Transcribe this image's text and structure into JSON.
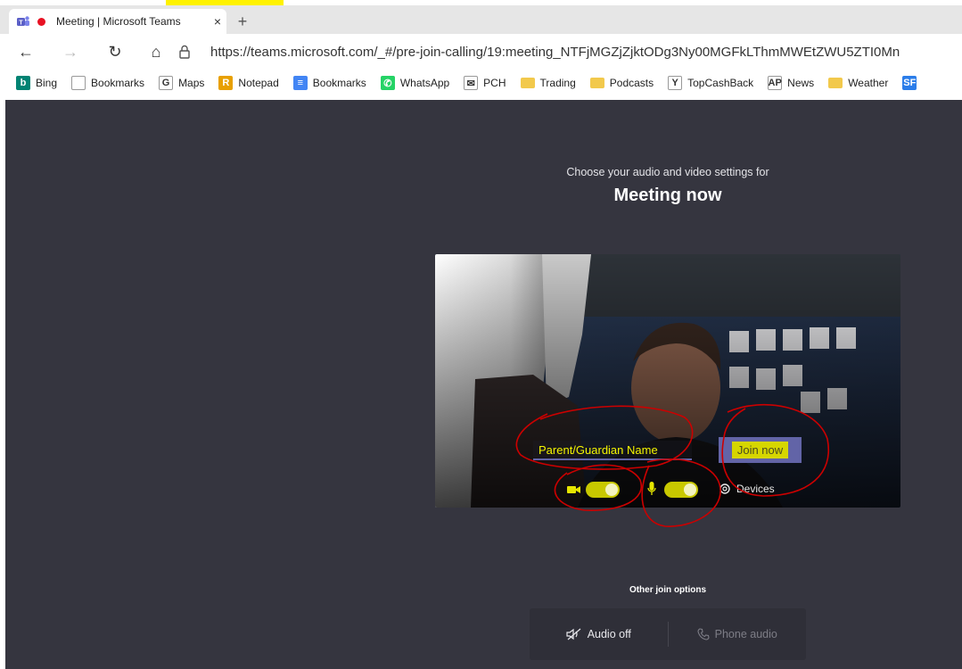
{
  "browser": {
    "tab_title": "Meeting | Microsoft Teams",
    "tab_close": "×",
    "new_tab": "+",
    "url": "https://teams.microsoft.com/_#/pre-join-calling/19:meeting_NTFjMGZjZjktODg3Ny00MGFkLThmMWEtZWU5ZTI0Mn",
    "back": "←",
    "forward": "→",
    "reload": "↻",
    "home": "⌂"
  },
  "bookmarks": [
    {
      "label": "Bing",
      "icon": "bing-icon",
      "color": "#008373",
      "glyph": "b"
    },
    {
      "label": "Bookmarks",
      "icon": "page-icon",
      "color": "#ffffff",
      "glyph": ""
    },
    {
      "label": "Maps",
      "icon": "google-icon",
      "color": "#ffffff",
      "glyph": "G"
    },
    {
      "label": "Notepad",
      "icon": "notepad-icon",
      "color": "#e8a000",
      "glyph": "R"
    },
    {
      "label": "Bookmarks",
      "icon": "docs-icon",
      "color": "#4285f4",
      "glyph": "≡"
    },
    {
      "label": "WhatsApp",
      "icon": "whatsapp-icon",
      "color": "#25d366",
      "glyph": "✆"
    },
    {
      "label": "PCH",
      "icon": "envelope-icon",
      "color": "#ffffff",
      "glyph": "✉"
    },
    {
      "label": "Trading",
      "icon": "folder-icon",
      "color": "#f2c94c",
      "glyph": ""
    },
    {
      "label": "Podcasts",
      "icon": "folder-icon",
      "color": "#f2c94c",
      "glyph": ""
    },
    {
      "label": "TopCashBack",
      "icon": "topcashback-icon",
      "color": "#ffffff",
      "glyph": "Y"
    },
    {
      "label": "News",
      "icon": "ap-icon",
      "color": "#ffffff",
      "glyph": "AP"
    },
    {
      "label": "Weather",
      "icon": "folder-icon",
      "color": "#f2c94c",
      "glyph": ""
    },
    {
      "label": "",
      "icon": "sf-icon",
      "color": "#2b7de9",
      "glyph": "SF"
    }
  ],
  "prejoin": {
    "subtitle": "Choose your audio and video settings for",
    "title": "Meeting now",
    "name_value": "Parent/Guardian Name",
    "join_label": "Join now",
    "devices_label": "Devices",
    "camera_on": true,
    "mic_on": true
  },
  "other_options": {
    "label": "Other join options",
    "audio_off": "Audio off",
    "phone_audio": "Phone audio"
  },
  "colors": {
    "stage_bg": "#35353f",
    "teams_purple": "#6264a7",
    "highlight_yellow": "#d6d600",
    "annotation_red": "#cc0000"
  }
}
